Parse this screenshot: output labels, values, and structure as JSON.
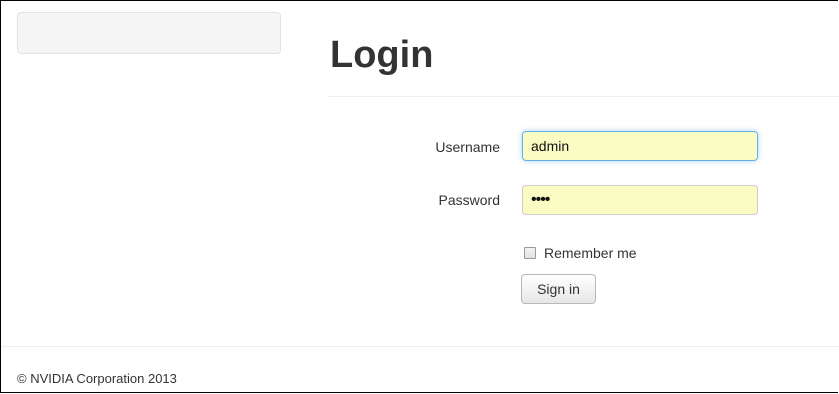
{
  "page": {
    "title": "Login"
  },
  "form": {
    "username": {
      "label": "Username",
      "value": "admin"
    },
    "password": {
      "label": "Password",
      "value": "••••"
    },
    "remember": {
      "label": "Remember me",
      "checked": false
    },
    "submit_label": "Sign in"
  },
  "footer": {
    "text": "© NVIDIA Corporation 2013"
  },
  "colors": {
    "input_autofill_bg": "#fbfcc4",
    "focus_border": "#66afe9",
    "text": "#333333"
  }
}
